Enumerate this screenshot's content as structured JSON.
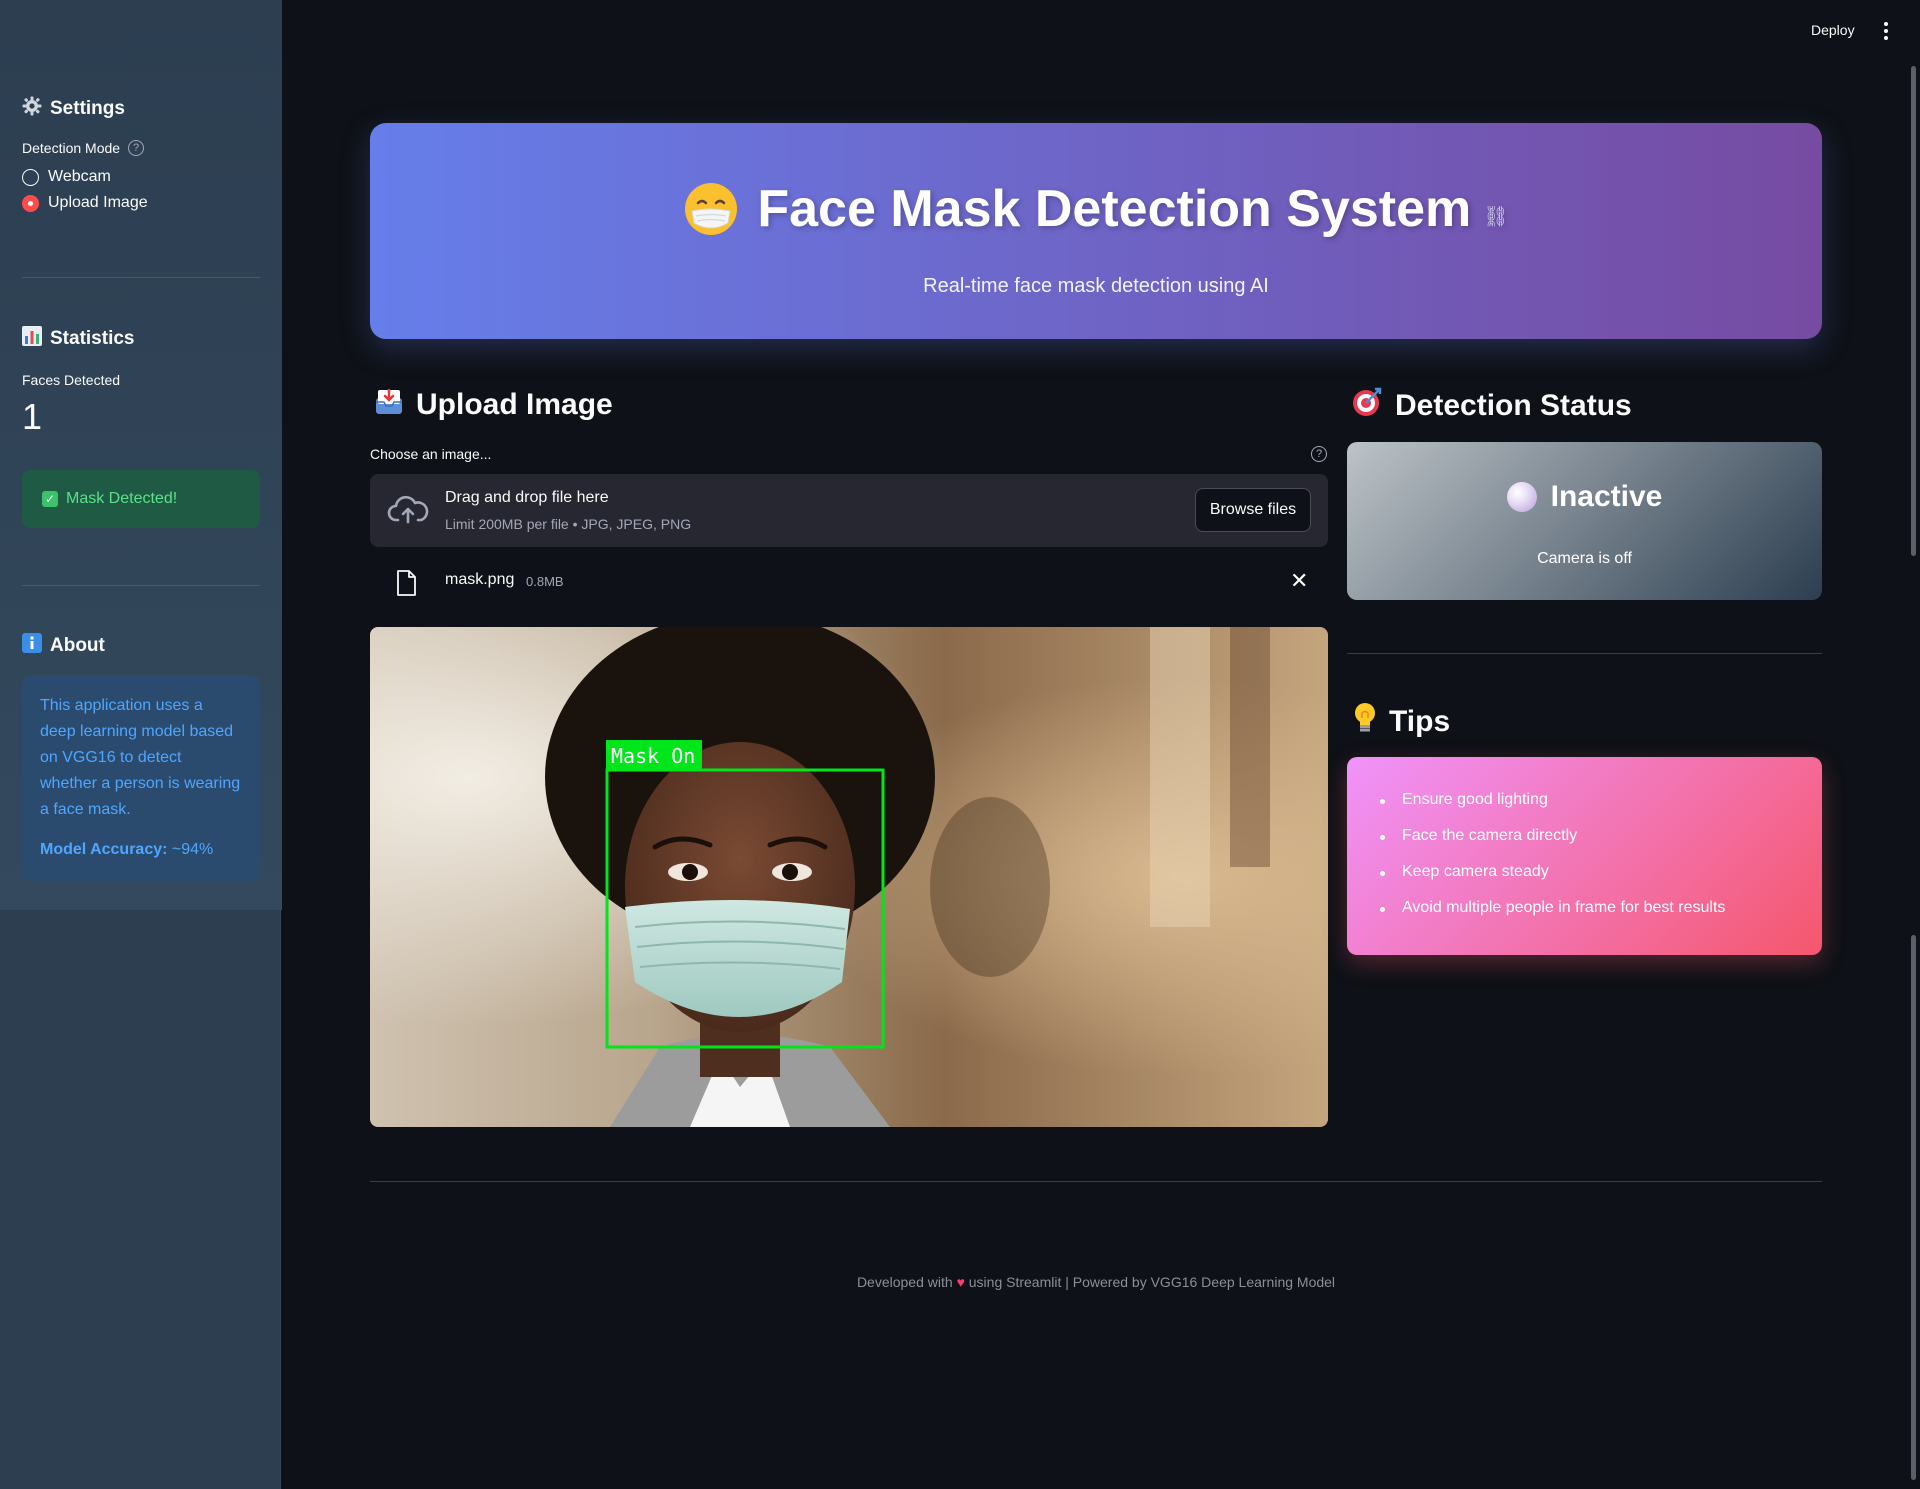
{
  "topbar": {
    "deploy_label": "Deploy"
  },
  "sidebar": {
    "settings_title": "Settings",
    "detection_mode_label": "Detection Mode",
    "modes": [
      {
        "label": "Webcam",
        "selected": false
      },
      {
        "label": "Upload Image",
        "selected": true
      }
    ],
    "statistics_title": "Statistics",
    "faces_detected_label": "Faces Detected",
    "faces_detected_value": "1",
    "mask_alert": "Mask Detected!",
    "about_title": "About",
    "about_text": "This application uses a deep learning model based on VGG16 to detect whether a person is wearing a face mask.",
    "accuracy_label": "Model Accuracy:",
    "accuracy_value": " ~94%"
  },
  "hero": {
    "title": "Face Mask Detection System",
    "subtitle": "Real-time face mask detection using AI",
    "gradient": [
      "#667eea",
      "#764ba2"
    ]
  },
  "upload": {
    "heading": "Upload Image",
    "choose_label": "Choose an image...",
    "dropzone_title": "Drag and drop file here",
    "dropzone_limit": "Limit 200MB per file • JPG, JPEG, PNG",
    "browse_label": "Browse files",
    "file_name": "mask.png",
    "file_size": "0.8MB",
    "detection_label": "Mask On"
  },
  "status": {
    "heading": "Detection Status",
    "state": "Inactive",
    "subtitle": "Camera is off"
  },
  "tips": {
    "heading": "Tips",
    "items": [
      "Ensure good lighting",
      "Face the camera directly",
      "Keep camera steady",
      "Avoid multiple people in frame for best results"
    ]
  },
  "footer": {
    "prefix": "Developed with",
    "suffix": "using Streamlit | Powered by VGG16 Deep Learning Model"
  },
  "colors": {
    "accent_red": "#ff4b4b",
    "success_green": "#5ce08a",
    "info_blue": "#4fa6ff",
    "detection_box": "#00e61a"
  }
}
